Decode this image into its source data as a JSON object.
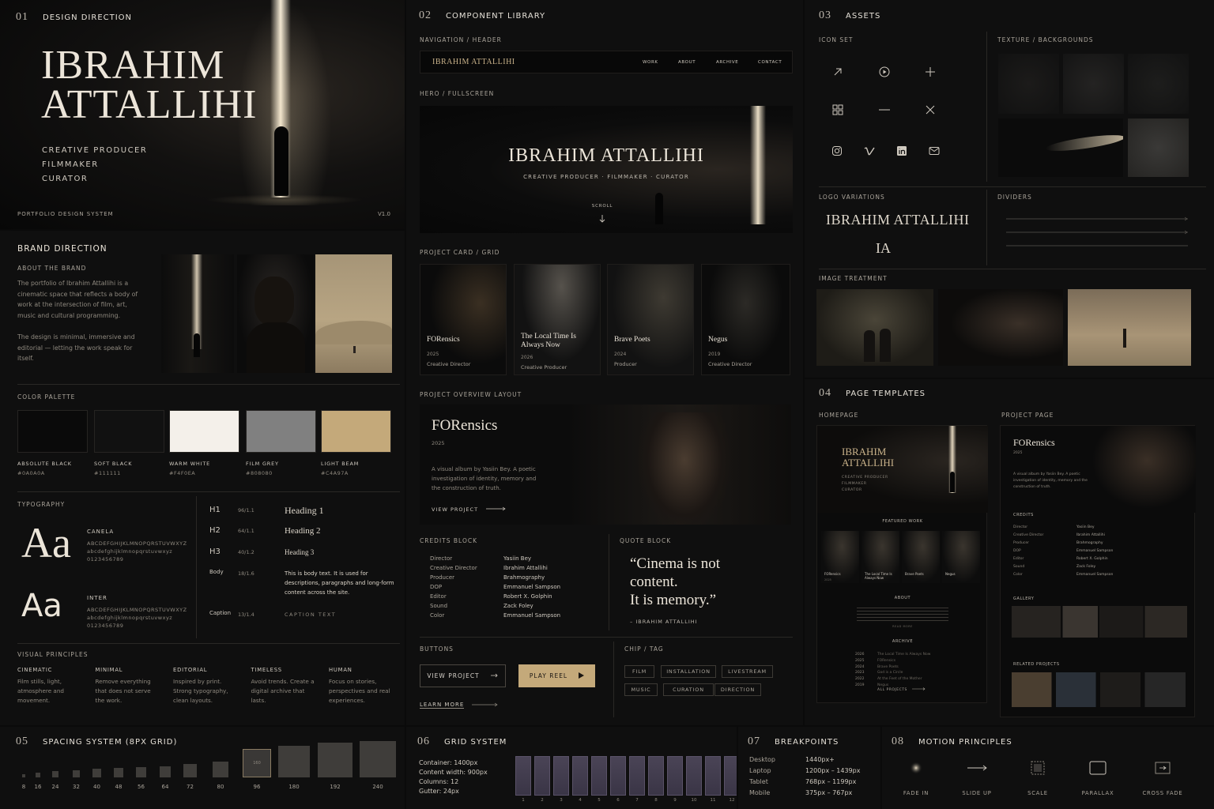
{
  "design": {
    "num": "01",
    "label": "DESIGN DIRECTION",
    "name_line1": "IBRAHIM",
    "name_line2": "ATTALLIHI",
    "roles": [
      "CREATIVE PRODUCER",
      "FILMMAKER",
      "CURATOR"
    ],
    "footer_left": "PORTFOLIO DESIGN SYSTEM",
    "footer_right": "V1.0"
  },
  "brand": {
    "title": "BRAND DIRECTION",
    "about_label": "ABOUT THE BRAND",
    "about_p1": "The portfolio of Ibrahim Attallihi is a cinematic space that reflects a body of work at the intersection of film, art, music and cultural programming.",
    "about_p2": "The design is minimal, immersive and editorial — letting the work speak for itself."
  },
  "palette": {
    "label": "COLOR PALETTE",
    "swatches": [
      {
        "name": "ABSOLUTE BLACK",
        "hex": "#0A0A0A",
        "color": "#0a0a0a"
      },
      {
        "name": "SOFT BLACK",
        "hex": "#111111",
        "color": "#111111"
      },
      {
        "name": "WARM WHITE",
        "hex": "#F4F0EA",
        "color": "#f4f0ea"
      },
      {
        "name": "FILM GREY",
        "hex": "#808080",
        "color": "#808080"
      },
      {
        "name": "LIGHT BEAM",
        "hex": "#C4A97A",
        "color": "#c4a97a"
      }
    ]
  },
  "typography": {
    "label": "TYPOGRAPHY",
    "serif_sample": "Aa",
    "serif_name": "CANELA",
    "serif_chars": "ABCDEFGHIJKLMNOPQRSTUVWXYZ",
    "serif_lower": "abcdefghijklmnopqrstuvwxyz",
    "serif_digits": "0123456789",
    "sans_sample": "Aa",
    "sans_name": "INTER",
    "sans_chars": "ABCDEFGHIJKLMNOPQRSTUVWXYZ",
    "sans_lower": "abcdefghijklmnopqrstuvwxyz",
    "sans_digits": "0123456789",
    "scale": [
      {
        "tag": "H1",
        "size": "96/1.1",
        "sample": "Heading 1"
      },
      {
        "tag": "H2",
        "size": "64/1.1",
        "sample": "Heading 2"
      },
      {
        "tag": "H3",
        "size": "40/1.2",
        "sample": "Heading 3"
      },
      {
        "tag": "Body",
        "size": "18/1.6",
        "sample": "This is body text. It is used for descriptions, paragraphs and long-form content across the site."
      },
      {
        "tag": "Caption",
        "size": "13/1.4",
        "sample": "CAPTION TEXT"
      }
    ]
  },
  "principles": {
    "label": "VISUAL PRINCIPLES",
    "items": [
      {
        "title": "CINEMATIC",
        "text": "Film stills, light, atmosphere and movement."
      },
      {
        "title": "MINIMAL",
        "text": "Remove everything that does not serve the work."
      },
      {
        "title": "EDITORIAL",
        "text": "Inspired by print. Strong typography, clean layouts."
      },
      {
        "title": "TIMELESS",
        "text": "Avoid trends. Create a digital archive that lasts."
      },
      {
        "title": "HUMAN",
        "text": "Focus on stories, perspectives and real experiences."
      }
    ]
  },
  "components": {
    "num": "02",
    "label": "COMPONENT LIBRARY",
    "nav_label": "NAVIGATION / HEADER",
    "nav_brand": "IBRAHIM ATTALLIHI",
    "nav_items": [
      "WORK",
      "ABOUT",
      "ARCHIVE",
      "CONTACT"
    ],
    "hero_label": "HERO / FULLSCREEN",
    "hero_title": "IBRAHIM ATTALLIHI",
    "hero_sub": "CREATIVE PRODUCER · FILMMAKER · CURATOR",
    "hero_scroll": "SCROLL",
    "cards_label": "PROJECT CARD / GRID",
    "cards": [
      {
        "title": "FORensics",
        "year": "2025",
        "role": "Creative Director"
      },
      {
        "title": "The Local Time Is Always Now",
        "year": "2026",
        "role": "Creative Producer"
      },
      {
        "title": "Brave Poets",
        "year": "2024",
        "role": "Producer"
      },
      {
        "title": "Negus",
        "year": "2019",
        "role": "Creative Director"
      }
    ],
    "overview_label": "PROJECT OVERVIEW LAYOUT",
    "overview_title": "FORensics",
    "overview_year": "2025",
    "overview_text": "A visual album by Yasiin Bey. A poetic investigation of identity, memory and the construction of truth.",
    "overview_link": "VIEW PROJECT",
    "credits_label": "CREDITS BLOCK",
    "credits": [
      {
        "role": "Director",
        "name": "Yasiin Bey"
      },
      {
        "role": "Creative Director",
        "name": "Ibrahim Attallihi"
      },
      {
        "role": "Producer",
        "name": "Brahmography"
      },
      {
        "role": "DOP",
        "name": "Emmanuel Sampson"
      },
      {
        "role": "Editor",
        "name": "Robert X. Golphin"
      },
      {
        "role": "Sound",
        "name": "Zack Foley"
      },
      {
        "role": "Color",
        "name": "Emmanuel Sampson"
      }
    ],
    "quote_label": "QUOTE BLOCK",
    "quote_l1": "“Cinema is not",
    "quote_l2": "content.",
    "quote_l3": "It is memory.”",
    "quote_author": "– IBRAHIM ATTALLIHI",
    "buttons_label": "BUTTONS",
    "btn_view": "VIEW PROJECT",
    "btn_play": "PLAY REEL",
    "btn_learn": "LEARN MORE",
    "chips_label": "CHIP / TAG",
    "chips": [
      "FILM",
      "INSTALLATION",
      "LIVESTREAM",
      "MUSIC",
      "CURATION",
      "DIRECTION"
    ]
  },
  "assets": {
    "num": "03",
    "label": "ASSETS",
    "icon_label": "ICON SET",
    "texture_label": "TEXTURE / BACKGROUNDS",
    "logo_label": "LOGO VARIATIONS",
    "logo_full": "IBRAHIM ATTALLIHI",
    "logo_mono": "IA",
    "dividers_label": "DIVIDERS",
    "treatment_label": "IMAGE TREATMENT",
    "icons": [
      "arrow-up-right-icon",
      "play-circle-icon",
      "plus-icon",
      "grid-icon",
      "minus-icon",
      "close-icon",
      "instagram-icon",
      "vimeo-icon",
      "linkedin-icon",
      "mail-icon"
    ]
  },
  "templates": {
    "num": "04",
    "label": "PAGE TEMPLATES",
    "home_label": "HOMEPAGE",
    "project_label": "PROJECT PAGE",
    "home_title1": "IBRAHIM",
    "home_title2": "ATTALLIHI",
    "home_roles": [
      "CREATIVE PRODUCER",
      "FILMMAKER",
      "CURATOR"
    ],
    "home_featured": "FEATURED WORK",
    "home_cards": [
      "FORensics",
      "The Local Time Is Always Now",
      "Brave Poets",
      "Negus"
    ],
    "home_card_year": "2025",
    "home_about": "ABOUT",
    "home_read": "READ MORE",
    "home_archive": "ARCHIVE",
    "archive": [
      {
        "year": "2026",
        "title": "The Local Time Is Always Now"
      },
      {
        "year": "2025",
        "title": "FORensics"
      },
      {
        "year": "2024",
        "title": "Brave Poets"
      },
      {
        "year": "2023",
        "title": "God is a Circle"
      },
      {
        "year": "2022",
        "title": "At the Feet of the Mother"
      },
      {
        "year": "2019",
        "title": "Negus"
      }
    ],
    "home_all": "ALL PROJECTS",
    "proj_title": "FORensics",
    "proj_year": "2025",
    "proj_text": "A visual album by Yasiin Bey. A poetic investigation of identity, memory and the construction of truth.",
    "proj_credits": "CREDITS",
    "proj_gallery": "GALLERY",
    "proj_related": "RELATED PROJECTS"
  },
  "spacing": {
    "num": "05",
    "label": "SPACING SYSTEM (8PX GRID)",
    "values": [
      "8",
      "16",
      "24",
      "32",
      "40",
      "48",
      "56",
      "64",
      "72",
      "80",
      "96",
      "180",
      "192",
      "240"
    ],
    "marker": "160"
  },
  "grid": {
    "num": "06",
    "label": "GRID SYSTEM",
    "container": "Container: 1400px",
    "content": "Content width: 900px",
    "columns": "Columns: 12",
    "gutter": "Gutter: 24px",
    "cols": [
      "1",
      "2",
      "3",
      "4",
      "5",
      "6",
      "7",
      "8",
      "9",
      "10",
      "11",
      "12"
    ]
  },
  "breakpoints": {
    "num": "07",
    "label": "BREAKPOINTS",
    "items": [
      {
        "name": "Desktop",
        "value": "1440px+"
      },
      {
        "name": "Laptop",
        "value": "1200px – 1439px"
      },
      {
        "name": "Tablet",
        "value": "768px – 1199px"
      },
      {
        "name": "Mobile",
        "value": "375px – 767px"
      }
    ]
  },
  "motion": {
    "num": "08",
    "label": "MOTION PRINCIPLES",
    "items": [
      "FADE IN",
      "SLIDE UP",
      "SCALE",
      "PARALLAX",
      "CROSS FADE"
    ]
  }
}
